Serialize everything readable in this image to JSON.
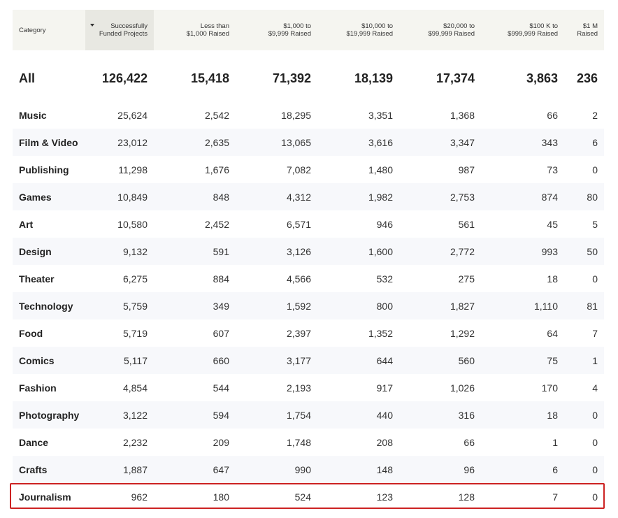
{
  "headers": [
    "Category",
    "Successfully\nFunded Projects",
    "Less than\n$1,000 Raised",
    "$1,000 to\n$9,999 Raised",
    "$10,000 to\n$19,999 Raised",
    "$20,000 to\n$99,999 Raised",
    "$100 K to\n$999,999 Raised",
    "$1 M\nRaised"
  ],
  "total": [
    "All",
    "126,422",
    "15,418",
    "71,392",
    "18,139",
    "17,374",
    "3,863",
    "236"
  ],
  "rows": [
    [
      "Music",
      "25,624",
      "2,542",
      "18,295",
      "3,351",
      "1,368",
      "66",
      "2"
    ],
    [
      "Film & Video",
      "23,012",
      "2,635",
      "13,065",
      "3,616",
      "3,347",
      "343",
      "6"
    ],
    [
      "Publishing",
      "11,298",
      "1,676",
      "7,082",
      "1,480",
      "987",
      "73",
      "0"
    ],
    [
      "Games",
      "10,849",
      "848",
      "4,312",
      "1,982",
      "2,753",
      "874",
      "80"
    ],
    [
      "Art",
      "10,580",
      "2,452",
      "6,571",
      "946",
      "561",
      "45",
      "5"
    ],
    [
      "Design",
      "9,132",
      "591",
      "3,126",
      "1,600",
      "2,772",
      "993",
      "50"
    ],
    [
      "Theater",
      "6,275",
      "884",
      "4,566",
      "532",
      "275",
      "18",
      "0"
    ],
    [
      "Technology",
      "5,759",
      "349",
      "1,592",
      "800",
      "1,827",
      "1,110",
      "81"
    ],
    [
      "Food",
      "5,719",
      "607",
      "2,397",
      "1,352",
      "1,292",
      "64",
      "7"
    ],
    [
      "Comics",
      "5,117",
      "660",
      "3,177",
      "644",
      "560",
      "75",
      "1"
    ],
    [
      "Fashion",
      "4,854",
      "544",
      "2,193",
      "917",
      "1,026",
      "170",
      "4"
    ],
    [
      "Photography",
      "3,122",
      "594",
      "1,754",
      "440",
      "316",
      "18",
      "0"
    ],
    [
      "Dance",
      "2,232",
      "209",
      "1,748",
      "208",
      "66",
      "1",
      "0"
    ],
    [
      "Crafts",
      "1,887",
      "647",
      "990",
      "148",
      "96",
      "6",
      "0"
    ],
    [
      "Journalism",
      "962",
      "180",
      "524",
      "123",
      "128",
      "7",
      "0"
    ]
  ],
  "highlight_color": "#cc2222",
  "sort_icon": "sort-desc-caret-icon"
}
